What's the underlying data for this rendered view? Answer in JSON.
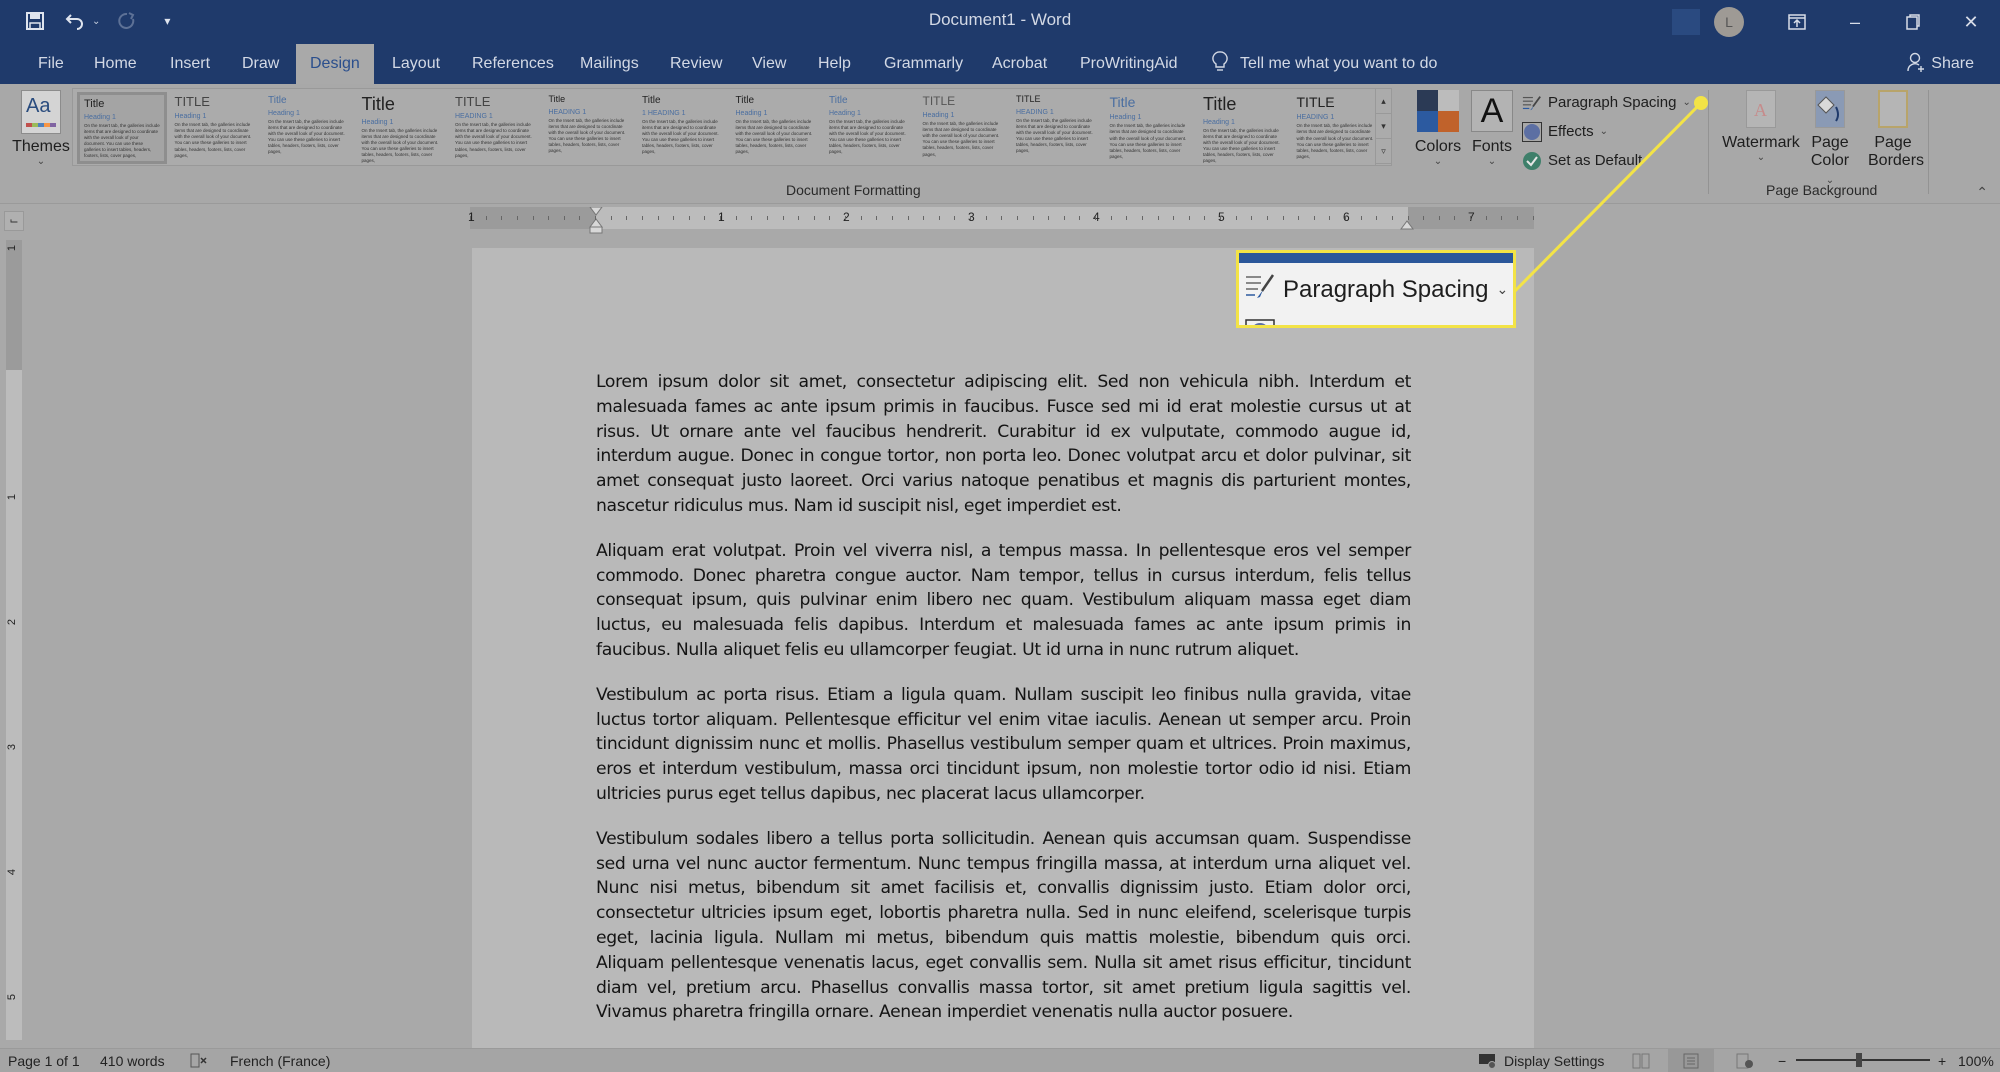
{
  "window": {
    "title": "Document1  -  Word",
    "account_initial": "L"
  },
  "quick_access": {
    "save": "save-icon",
    "undo": "undo-icon",
    "redo": "redo-icon",
    "customize": "customize-qat-icon"
  },
  "tabs": [
    {
      "label": "File"
    },
    {
      "label": "Home"
    },
    {
      "label": "Insert"
    },
    {
      "label": "Draw"
    },
    {
      "label": "Design",
      "active": true
    },
    {
      "label": "Layout"
    },
    {
      "label": "References"
    },
    {
      "label": "Mailings"
    },
    {
      "label": "Review"
    },
    {
      "label": "View"
    },
    {
      "label": "Help"
    },
    {
      "label": "Grammarly"
    },
    {
      "label": "Acrobat"
    },
    {
      "label": "ProWritingAid"
    }
  ],
  "tell_me": "Tell me what you want to do",
  "share": "Share",
  "ribbon": {
    "themes_label": "Themes",
    "gallery": [
      {
        "title": "Title",
        "heading": "Heading 1"
      },
      {
        "title": "TITLE",
        "heading": "Heading 1"
      },
      {
        "title": "Title",
        "heading": "Heading 1"
      },
      {
        "title": "Title",
        "heading": "Heading 1"
      },
      {
        "title": "TITLE",
        "heading": "HEADING 1"
      },
      {
        "title": "Title",
        "heading": "HEADING 1"
      },
      {
        "title": "Title",
        "heading": "1  HEADING 1"
      },
      {
        "title": "Title",
        "heading": "Heading 1"
      },
      {
        "title": "Title",
        "heading": "Heading 1"
      },
      {
        "title": "TITLE",
        "heading": "Heading 1"
      },
      {
        "title": "TITLE",
        "heading": "HEADING 1"
      },
      {
        "title": "Title",
        "heading": "Heading 1"
      },
      {
        "title": "Title",
        "heading": "Heading 1"
      },
      {
        "title": "TITLE",
        "heading": "HEADING 1"
      }
    ],
    "gallery_sample_text": "On the Insert tab, the galleries include items that are designed to coordinate with the overall look of your document. You can use these galleries to insert tables, headers, footers, lists, cover pages,",
    "document_formatting_label": "Document Formatting",
    "colors_label": "Colors",
    "colors_swatch": [
      "#2b3a55",
      "#bcbcbc",
      "#2c5aa0",
      "#c0622b"
    ],
    "fonts_label": "Fonts",
    "fonts_glyph": "A",
    "paragraph_spacing_label": "Paragraph Spacing",
    "effects_label": "Effects",
    "set_as_default_label": "Set as Default",
    "watermark_label": "Watermark",
    "page_color_label_1": "Page",
    "page_color_label_2": "Color",
    "page_borders_label_1": "Page",
    "page_borders_label_2": "Borders",
    "page_background_label": "Page Background"
  },
  "callout": {
    "label": "Paragraph Spacing",
    "highlight_color": "#f3e346"
  },
  "ruler": {
    "h_numbers": [
      "1",
      "1",
      "2",
      "3",
      "4",
      "5",
      "6",
      "7"
    ],
    "v_numbers": [
      "1",
      "1",
      "2",
      "3",
      "4",
      "5"
    ]
  },
  "document": {
    "paragraphs": [
      "Lorem ipsum dolor sit amet, consectetur adipiscing elit. Sed non vehicula nibh. Interdum et malesuada fames ac ante ipsum primis in faucibus. Fusce sed mi id erat molestie cursus ut at risus. Ut ornare ante vel faucibus hendrerit. Curabitur id ex vulputate, commodo augue id, interdum augue. Donec in congue tortor, non porta leo. Donec volutpat arcu et dolor pulvinar, sit amet consequat justo laoreet. Orci varius natoque penatibus et magnis dis parturient montes, nascetur ridiculus mus. Nam id suscipit nisl, eget imperdiet est.",
      "Aliquam erat volutpat. Proin vel viverra nisl, a tempus massa. In pellentesque eros vel semper commodo. Donec pharetra congue auctor. Nam tempor, tellus in cursus interdum, felis tellus consequat ipsum, quis pulvinar enim libero nec quam. Vestibulum aliquam massa eget diam luctus, eu malesuada felis dapibus. Interdum et malesuada fames ac ante ipsum primis in faucibus. Nulla aliquet felis eu ullamcorper feugiat. Ut id urna in nunc rutrum aliquet.",
      "Vestibulum ac porta risus. Etiam a ligula quam. Nullam suscipit leo finibus nulla gravida, vitae luctus tortor aliquam. Pellentesque efficitur vel enim vitae iaculis. Aenean ut semper arcu. Proin tincidunt dignissim nunc et mollis. Phasellus vestibulum semper quam et ultrices. Proin maximus, eros et interdum vestibulum, massa orci tincidunt ipsum, non molestie tortor odio id nisi. Etiam ultricies purus eget tellus dapibus, nec placerat lacus ullamcorper.",
      "Vestibulum sodales libero a tellus porta sollicitudin. Aenean quis accumsan quam. Suspendisse sed urna vel nunc auctor fermentum. Nunc tempus fringilla massa, at interdum urna aliquet vel. Nunc nisi metus, bibendum sit amet facilisis et, convallis dignissim justo. Etiam dolor orci, consectetur ultricies ipsum eget, lobortis pharetra nulla. Sed in nunc eleifend, scelerisque turpis eget, lacinia ligula. Nullam mi metus, bibendum quis mattis molestie, bibendum quis orci. Aliquam pellentesque venenatis lacus, eget convallis sem. Nulla sit amet risus efficitur, tincidunt diam vel, pretium arcu. Phasellus convallis massa tortor, sit amet pretium ligula sagittis vel. Vivamus pharetra fringilla ornare. Aenean imperdiet venenatis nulla auctor posuere."
    ]
  },
  "status": {
    "page": "Page 1 of 1",
    "words": "410 words",
    "language": "French (France)",
    "display_settings": "Display Settings",
    "zoom_minus": "−",
    "zoom_plus": "+",
    "zoom_level": "100%",
    "zoom_fraction": 0.5
  }
}
